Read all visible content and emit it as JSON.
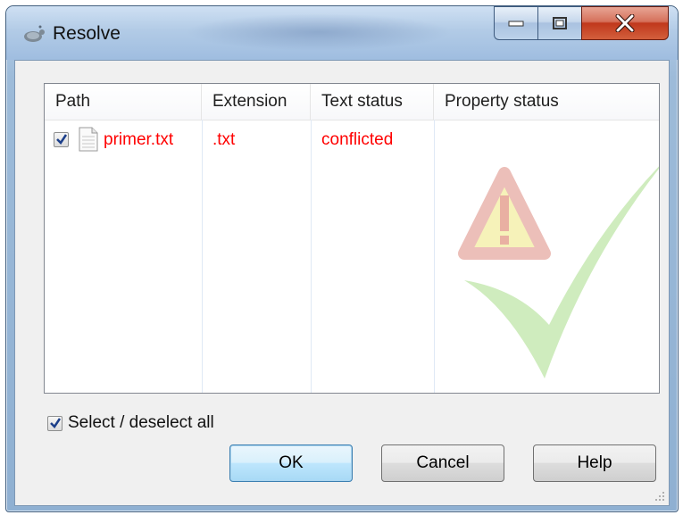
{
  "window": {
    "title": "Resolve",
    "controls": {
      "minimize": "minimize-icon",
      "maximize": "maximize-icon",
      "close": "close-icon"
    }
  },
  "list": {
    "columns": [
      "Path",
      "Extension",
      "Text status",
      "Property status"
    ],
    "rows": [
      {
        "checked": true,
        "path": "primer.txt",
        "extension": ".txt",
        "text_status": "conflicted",
        "property_status": ""
      }
    ]
  },
  "select_all": {
    "label": "Select / deselect all",
    "checked": true
  },
  "buttons": {
    "ok": "OK",
    "cancel": "Cancel",
    "help": "Help"
  },
  "colors": {
    "conflict_text": "#ff0000",
    "default_button": "#bee6fd",
    "titlebar": "#b9d1ea"
  }
}
